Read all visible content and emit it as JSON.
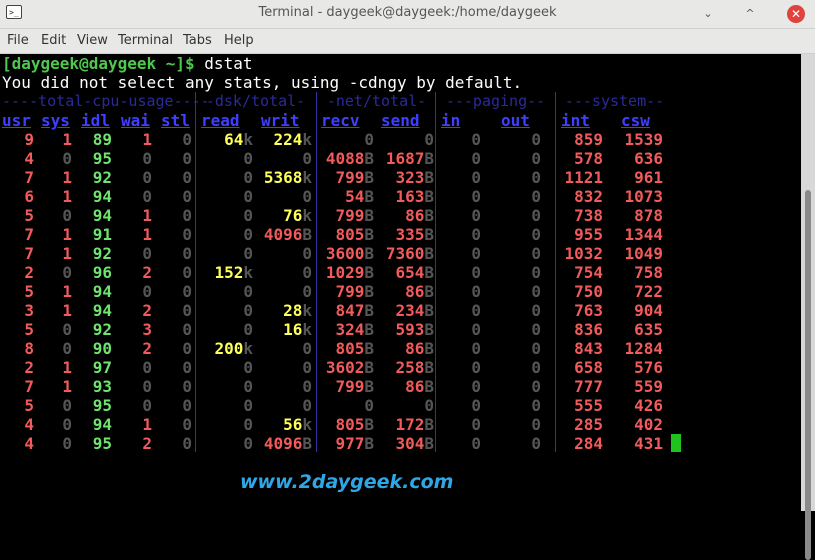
{
  "window": {
    "title": "Terminal - daygeek@daygeek:/home/daygeek",
    "app_icon": ">_",
    "buttons": {
      "minimize": "⌄",
      "maximize": "^",
      "close": "✕"
    }
  },
  "menu": [
    "File",
    "Edit",
    "View",
    "Terminal",
    "Tabs",
    "Help"
  ],
  "terminal": {
    "prompt": "[daygeek@daygeek ~]$",
    "command": "dstat",
    "info": "You did not select any stats, using -cdngy by default.",
    "groups": [
      "----total-cpu-usage----",
      "-dsk/total-",
      "-net/total-",
      "---paging--",
      "---system--"
    ],
    "columns": [
      "usr",
      "sys",
      "idl",
      "wai",
      "stl",
      "read",
      "writ",
      "recv",
      "send",
      "in",
      "out",
      "int",
      "csw"
    ],
    "rows": [
      [
        "9",
        "1",
        "89",
        "1",
        "0",
        "64k",
        "224k",
        "0",
        "0",
        "0",
        "0",
        "859",
        "1539"
      ],
      [
        "4",
        "0",
        "95",
        "0",
        "0",
        "0",
        "0",
        "4088B",
        "1687B",
        "0",
        "0",
        "578",
        "636"
      ],
      [
        "7",
        "1",
        "92",
        "0",
        "0",
        "0",
        "5368k",
        "799B",
        "323B",
        "0",
        "0",
        "1121",
        "961"
      ],
      [
        "6",
        "1",
        "94",
        "0",
        "0",
        "0",
        "0",
        "54B",
        "163B",
        "0",
        "0",
        "832",
        "1073"
      ],
      [
        "5",
        "0",
        "94",
        "1",
        "0",
        "0",
        "76k",
        "799B",
        "86B",
        "0",
        "0",
        "738",
        "878"
      ],
      [
        "7",
        "1",
        "91",
        "1",
        "0",
        "0",
        "4096B",
        "805B",
        "335B",
        "0",
        "0",
        "955",
        "1344"
      ],
      [
        "7",
        "1",
        "92",
        "0",
        "0",
        "0",
        "0",
        "3600B",
        "7360B",
        "0",
        "0",
        "1032",
        "1049"
      ],
      [
        "2",
        "0",
        "96",
        "2",
        "0",
        "152k",
        "0",
        "1029B",
        "654B",
        "0",
        "0",
        "754",
        "758"
      ],
      [
        "5",
        "1",
        "94",
        "0",
        "0",
        "0",
        "0",
        "799B",
        "86B",
        "0",
        "0",
        "750",
        "722"
      ],
      [
        "3",
        "1",
        "94",
        "2",
        "0",
        "0",
        "28k",
        "847B",
        "234B",
        "0",
        "0",
        "763",
        "904"
      ],
      [
        "5",
        "0",
        "92",
        "3",
        "0",
        "0",
        "16k",
        "324B",
        "593B",
        "0",
        "0",
        "836",
        "635"
      ],
      [
        "8",
        "0",
        "90",
        "2",
        "0",
        "200k",
        "0",
        "805B",
        "86B",
        "0",
        "0",
        "843",
        "1284"
      ],
      [
        "2",
        "1",
        "97",
        "0",
        "0",
        "0",
        "0",
        "3602B",
        "258B",
        "0",
        "0",
        "658",
        "576"
      ],
      [
        "7",
        "1",
        "93",
        "0",
        "0",
        "0",
        "0",
        "799B",
        "86B",
        "0",
        "0",
        "777",
        "559"
      ],
      [
        "5",
        "0",
        "95",
        "0",
        "0",
        "0",
        "0",
        "0",
        "0",
        "0",
        "0",
        "555",
        "426"
      ],
      [
        "4",
        "0",
        "94",
        "1",
        "0",
        "0",
        "56k",
        "805B",
        "172B",
        "0",
        "0",
        "285",
        "402"
      ],
      [
        "4",
        "0",
        "95",
        "2",
        "0",
        "0",
        "4096B",
        "977B",
        "304B",
        "0",
        "0",
        "284",
        "431"
      ]
    ]
  },
  "watermark": "www.2daygeek.com",
  "colors": {
    "prompt": "#4ec94e",
    "header": "#3f3fff",
    "group": "#2a2a9a",
    "value": "#f25b5b",
    "idle": "#6fe36f",
    "disk": "#ffff5a",
    "zero": "#555555",
    "cursor": "#1ec31e",
    "watermark": "#2fa7e6"
  }
}
